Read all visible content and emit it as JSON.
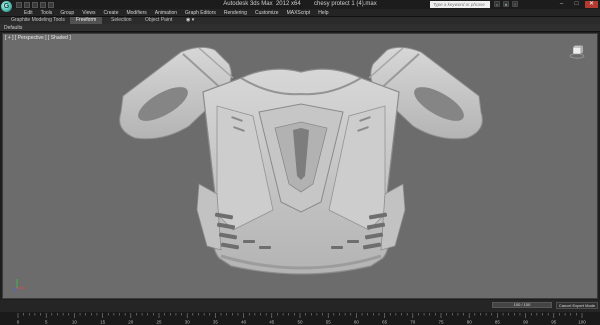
{
  "window": {
    "title": "Autodesk 3ds Max  2012 x64        chesy protect 1 (4).max",
    "logo_glyph": "G",
    "search_placeholder": "Type a keyword or phrase",
    "controls": {
      "minimize": "–",
      "maximize": "□",
      "close": "✕"
    },
    "icons": [
      "binoculars-icon",
      "star-icon",
      "help-icon"
    ]
  },
  "menubar": {
    "items": [
      "Edit",
      "Tools",
      "Group",
      "Views",
      "Create",
      "Modifiers",
      "Animation",
      "Graph Editors",
      "Rendering",
      "Customize",
      "MAXScript",
      "Help"
    ]
  },
  "ribbon": {
    "title": "Graphite Modeling Tools",
    "tabs": [
      "Freeform",
      "Selection",
      "Object Paint"
    ],
    "active_tab": "Freeform",
    "toggle_glyph": "◉ ▾",
    "panel_label": "Defaults"
  },
  "viewport": {
    "label": "[ + ] [ Perspective ] [ Shaded ]",
    "background_color": "#6c6c6c",
    "model_color": "#c9c9c9"
  },
  "trackbar": {
    "time_display": "100 / 100",
    "expert_mode_label": "Cancel Expert Mode"
  },
  "timeline": {
    "tick_labels": [
      "0",
      "5",
      "10",
      "15",
      "20",
      "25",
      "30",
      "35",
      "40",
      "45",
      "50",
      "55",
      "60",
      "65",
      "70",
      "75",
      "80",
      "85",
      "90",
      "95",
      "100"
    ]
  }
}
